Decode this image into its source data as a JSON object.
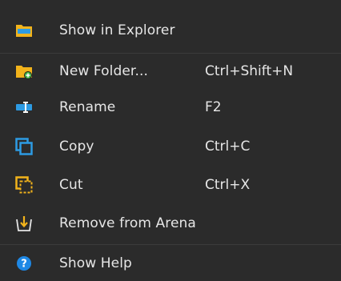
{
  "menu": {
    "items": [
      {
        "label": "Show in Explorer",
        "shortcut": "",
        "icon": "folder-open-icon"
      },
      {
        "label": "New Folder...",
        "shortcut": "Ctrl+Shift+N",
        "icon": "new-folder-icon"
      },
      {
        "label": "Rename",
        "shortcut": "F2",
        "icon": "rename-icon"
      },
      {
        "label": "Copy",
        "shortcut": "Ctrl+C",
        "icon": "copy-icon"
      },
      {
        "label": "Cut",
        "shortcut": "Ctrl+X",
        "icon": "cut-icon"
      },
      {
        "label": "Remove from Arena",
        "shortcut": "",
        "icon": "remove-icon"
      },
      {
        "label": "Show Help",
        "shortcut": "",
        "icon": "help-icon"
      }
    ]
  },
  "colors": {
    "background": "#2b2b2b",
    "text": "#e6e6e6",
    "separator": "#3b3b3b",
    "folder_yellow": "#f2b31b",
    "accent_blue": "#2d9be3",
    "help_blue": "#1e88e5"
  }
}
